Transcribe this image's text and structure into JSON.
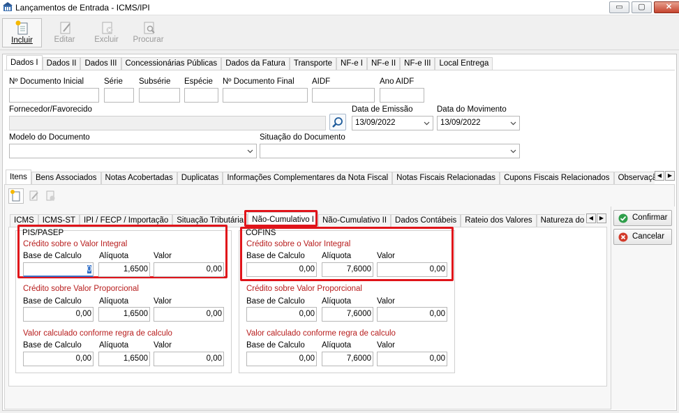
{
  "window": {
    "title": "Lançamentos de Entrada - ICMS/IPI",
    "controls": {
      "minimize": "▭",
      "maximize": "▢",
      "close": "✕"
    }
  },
  "toolbar": {
    "incluir": "Incluir",
    "editar": "Editar",
    "excluir": "Excluir",
    "procurar": "Procurar"
  },
  "tabs_top": [
    "Dados I",
    "Dados II",
    "Dados III",
    "Concessionárias Públicas",
    "Dados da Fatura",
    "Transporte",
    "NF-e I",
    "NF-e II",
    "NF-e III",
    "Local Entrega"
  ],
  "form": {
    "doc_inicial_label": "Nº Documento Inicial",
    "serie_label": "Série",
    "subserie_label": "Subsérie",
    "especie_label": "Espécie",
    "doc_final_label": "Nº Documento Final",
    "aidf_label": "AIDF",
    "ano_aidf_label": "Ano AIDF",
    "fornecedor_label": "Fornecedor/Favorecido",
    "data_emissao_label": "Data de Emissão",
    "data_emissao": "13/09/2022",
    "data_movimento_label": "Data do Movimento",
    "data_movimento": "13/09/2022",
    "modelo_label": "Modelo do Documento",
    "situacao_label": "Situação do Documento"
  },
  "tabs_mid": [
    "Itens",
    "Bens Associados",
    "Notas Acobertadas",
    "Duplicatas",
    "Informações Complementares da Nota Fiscal",
    "Notas Fiscais Relacionadas",
    "Cupons Fiscais Relacionados",
    "Observaçã"
  ],
  "tabs_inner": [
    "ICMS",
    "ICMS-ST",
    "IPI / FECP / Importação",
    "Situação Tributária",
    "Não-Cumulativo I",
    "Não-Cumulativo II",
    "Dados Contábeis",
    "Rateio dos Valores",
    "Natureza do"
  ],
  "pis": {
    "title": "PIS/PASEP",
    "sections": [
      {
        "heading": "Crédito sobre o Valor Integral",
        "base_label": "Base de Calculo",
        "aliquota_label": "Alíquota",
        "valor_label": "Valor",
        "base": "0",
        "aliquota": "1,6500",
        "valor": "0,00"
      },
      {
        "heading": "Crédito sobre Valor Proporcional",
        "base_label": "Base de Calculo",
        "aliquota_label": "Alíquota",
        "valor_label": "Valor",
        "base": "0,00",
        "aliquota": "1,6500",
        "valor": "0,00"
      },
      {
        "heading": "Valor calculado conforme regra de calculo",
        "base_label": "Base de Calculo",
        "aliquota_label": "Alíquota",
        "valor_label": "Valor",
        "base": "0,00",
        "aliquota": "1,6500",
        "valor": "0,00"
      }
    ]
  },
  "cofins": {
    "title": "COFINS",
    "sections": [
      {
        "heading": "Crédito sobre o Valor Integral",
        "base_label": "Base de Calculo",
        "aliquota_label": "Alíquota",
        "valor_label": "Valor",
        "base": "0,00",
        "aliquota": "7,6000",
        "valor": "0,00"
      },
      {
        "heading": "Crédito sobre Valor Proporcional",
        "base_label": "Base de Calculo",
        "aliquota_label": "Alíquota",
        "valor_label": "Valor",
        "base": "0,00",
        "aliquota": "7,6000",
        "valor": "0,00"
      },
      {
        "heading": "Valor calculado conforme regra de calculo",
        "base_label": "Base de Calculo",
        "aliquota_label": "Alíquota",
        "valor_label": "Valor",
        "base": "0,00",
        "aliquota": "7,6000",
        "valor": "0,00"
      }
    ]
  },
  "actions": {
    "confirmar": "Confirmar",
    "cancelar": "Cancelar"
  },
  "colors": {
    "highlight_red": "#e0141a",
    "heading_red": "#b71c1c",
    "confirm_green": "#2e9e4a",
    "cancel_red": "#d23a2a"
  }
}
